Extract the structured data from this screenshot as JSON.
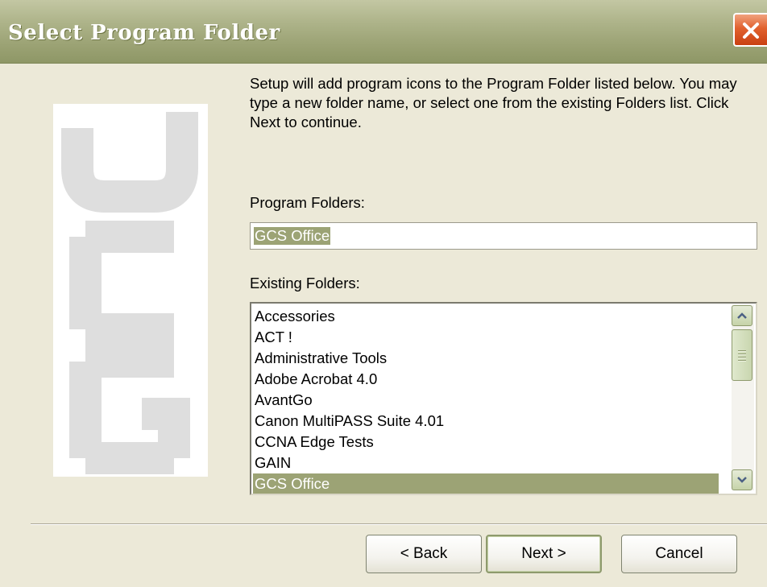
{
  "window": {
    "title": "Select Program Folder"
  },
  "logo": {
    "text": "GCS"
  },
  "instructions": "Setup will add program icons to the Program Folder listed below.  You may type a new folder name, or select one from the existing Folders list.  Click Next to continue.",
  "program_folders": {
    "label": "Program Folders:",
    "value": "GCS Office"
  },
  "existing_folders": {
    "label": "Existing Folders:",
    "items": [
      "Accessories",
      "ACT !",
      "Administrative Tools",
      "Adobe Acrobat 4.0",
      "AvantGo",
      "Canon MultiPASS Suite 4.01",
      "CCNA Edge Tests",
      "GAIN",
      "GCS Office"
    ],
    "selected": "GCS Office"
  },
  "buttons": {
    "back": "< Back",
    "next": "Next >",
    "cancel": "Cancel"
  },
  "colors": {
    "title_bar": "#9ca375",
    "selection": "#9ca375",
    "close_button": "#e1612e",
    "face": "#ece9d8"
  }
}
